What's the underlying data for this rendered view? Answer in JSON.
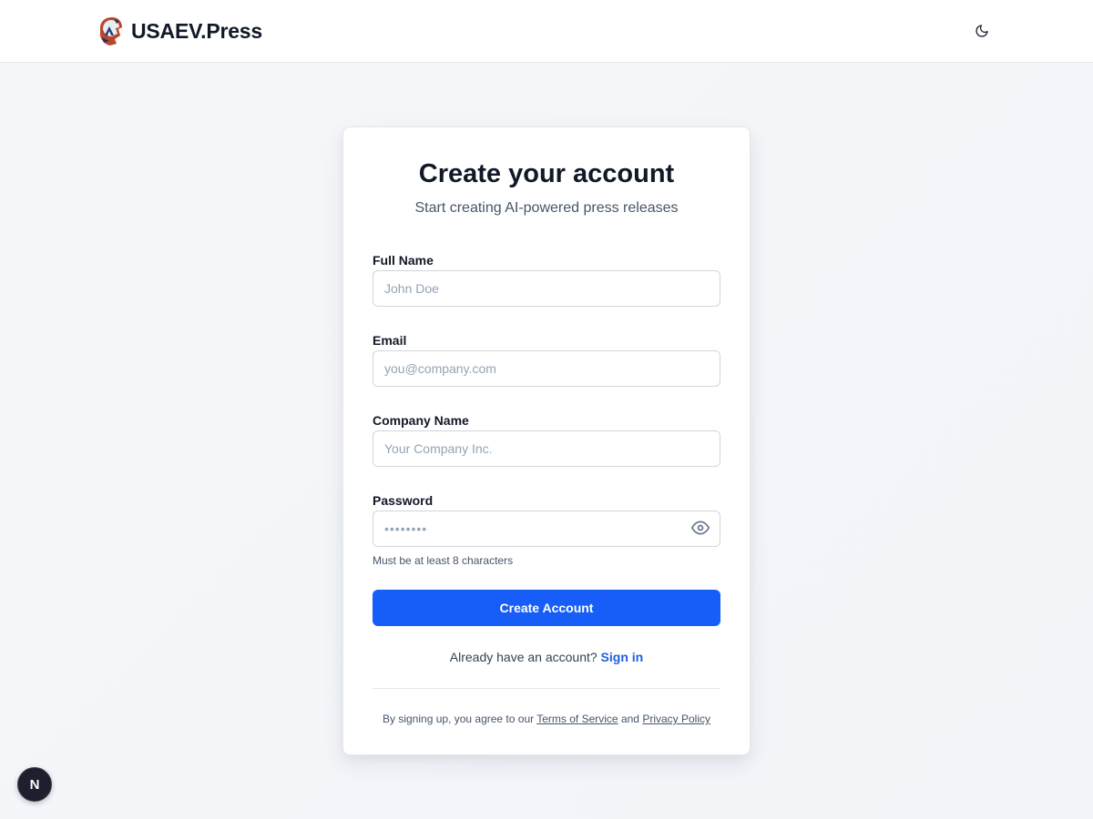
{
  "header": {
    "brand_name": "USAEV.Press",
    "logo_icon": "usaev-press-logo",
    "theme_toggle_icon": "moon-icon"
  },
  "card": {
    "title": "Create your account",
    "subtitle": "Start creating AI-powered press releases"
  },
  "form": {
    "full_name": {
      "label": "Full Name",
      "placeholder": "John Doe",
      "value": ""
    },
    "email": {
      "label": "Email",
      "placeholder": "you@company.com",
      "value": ""
    },
    "company": {
      "label": "Company Name",
      "placeholder": "Your Company Inc.",
      "value": ""
    },
    "password": {
      "label": "Password",
      "placeholder": "••••••••",
      "value": "",
      "toggle_icon": "eye-icon"
    },
    "password_hint": "Must be at least 8 characters",
    "submit_label": "Create Account"
  },
  "signin": {
    "prompt": "Already have an account?",
    "link_label": "Sign in"
  },
  "legal": {
    "prefix": "By signing up, you agree to our",
    "terms_label": "Terms of Service",
    "and": "and",
    "privacy_label": "Privacy Policy"
  },
  "dev_badge": {
    "letter": "N"
  },
  "colors": {
    "primary": "#165ef7",
    "link": "#1d5fe0",
    "background": "#f4f6f9",
    "card": "#ffffff",
    "heading": "#111827"
  }
}
